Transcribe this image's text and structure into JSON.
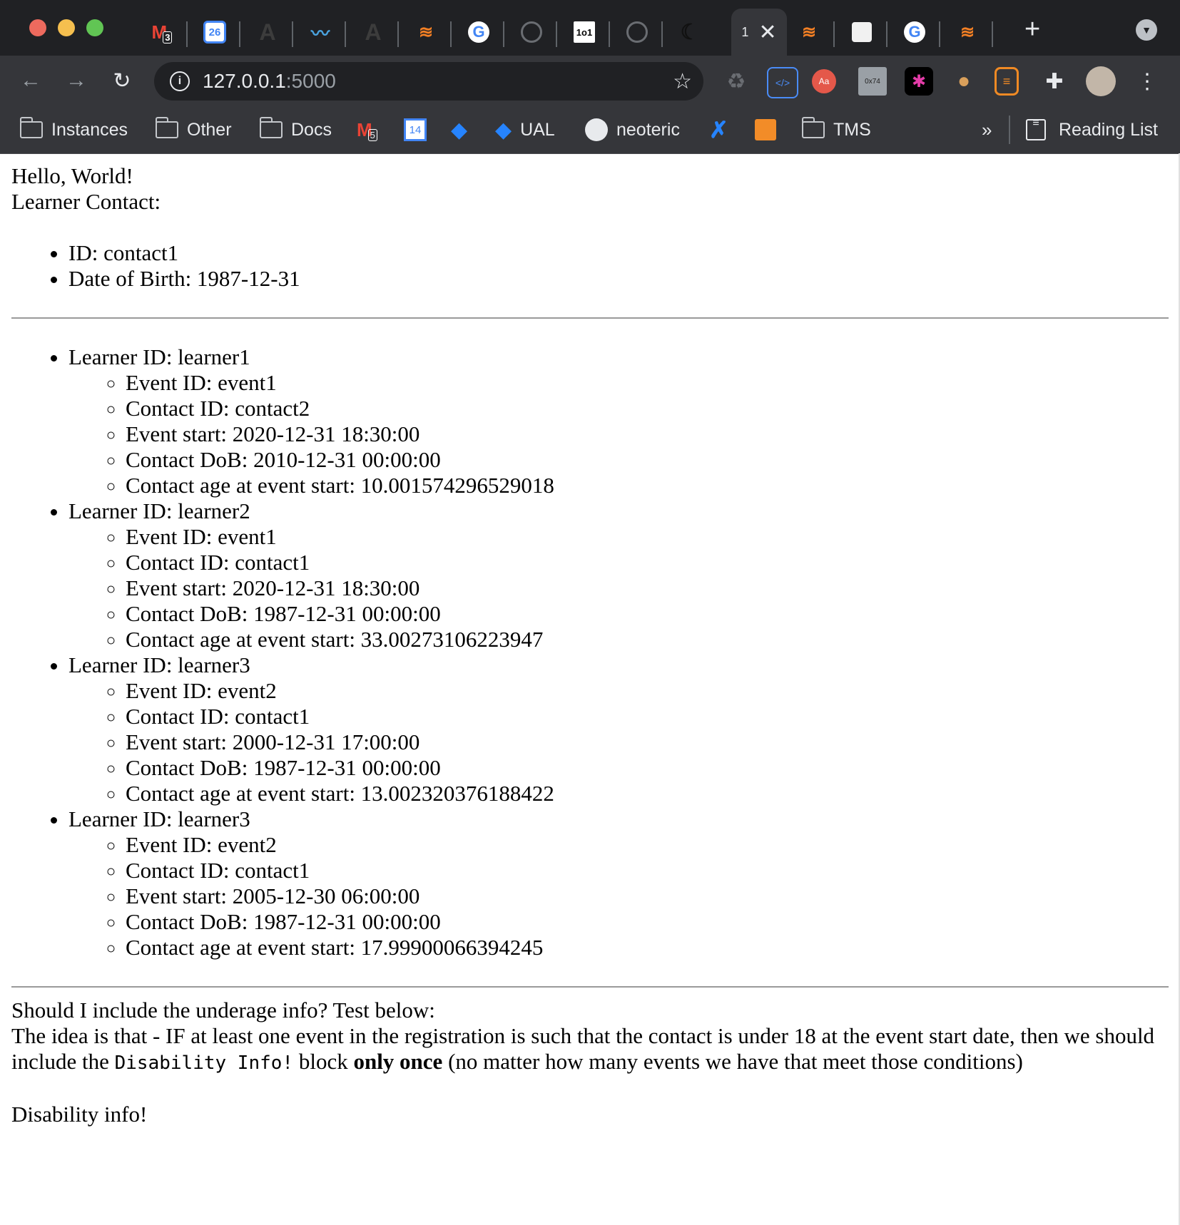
{
  "tabs": [
    {
      "icon": "gmail-icon",
      "badge": "3"
    },
    {
      "icon": "google-calendar-icon",
      "badge": "26"
    },
    {
      "icon": "font-a-icon"
    },
    {
      "icon": "wave-bird-icon"
    },
    {
      "icon": "font-a-icon"
    },
    {
      "icon": "stackoverflow-icon"
    },
    {
      "icon": "google-icon"
    },
    {
      "icon": "globe-icon"
    },
    {
      "icon": "101-icon",
      "text": "1o1"
    },
    {
      "icon": "globe-icon"
    },
    {
      "icon": "moon-icon"
    },
    {
      "icon": "active-tab",
      "text": "1"
    },
    {
      "icon": "stackoverflow-icon"
    },
    {
      "icon": "cube-icon"
    },
    {
      "icon": "google-icon"
    },
    {
      "icon": "stackoverflow-icon"
    }
  ],
  "toolbar": {
    "url_host": "127.0.0.1",
    "url_port": ":5000",
    "ext_hex": "0x74"
  },
  "bookmarks": {
    "instances": "Instances",
    "other": "Other",
    "docs": "Docs",
    "gmail_badge": "5",
    "calendar_badge": "14",
    "ual": "UAL",
    "neoteric": "neoteric",
    "tms": "TMS",
    "more": "»",
    "reading_list": "Reading List"
  },
  "page": {
    "hello": "Hello, World!",
    "learner_contact": "Learner Contact:",
    "contact_items": [
      "ID: contact1",
      "Date of Birth: 1987-12-31"
    ],
    "learners": [
      {
        "label": "Learner ID: learner1",
        "details": [
          "Event ID: event1",
          "Contact ID: contact2",
          "Event start: 2020-12-31 18:30:00",
          "Contact DoB: 2010-12-31 00:00:00",
          "Contact age at event start: 10.001574296529018"
        ]
      },
      {
        "label": "Learner ID: learner2",
        "details": [
          "Event ID: event1",
          "Contact ID: contact1",
          "Event start: 2020-12-31 18:30:00",
          "Contact DoB: 1987-12-31 00:00:00",
          "Contact age at event start: 33.00273106223947"
        ]
      },
      {
        "label": "Learner ID: learner3",
        "details": [
          "Event ID: event2",
          "Contact ID: contact1",
          "Event start: 2000-12-31 17:00:00",
          "Contact DoB: 1987-12-31 00:00:00",
          "Contact age at event start: 13.002320376188422"
        ]
      },
      {
        "label": "Learner ID: learner3",
        "details": [
          "Event ID: event2",
          "Contact ID: contact1",
          "Event start: 2005-12-30 06:00:00",
          "Contact DoB: 1987-12-31 00:00:00",
          "Contact age at event start: 17.99900066394245"
        ]
      }
    ],
    "question": "Should I include the underage info? Test below:",
    "idea_part1": "The idea is that - IF at least one event in the registration is such that the contact is under 18 at the event start date, then we should include the ",
    "idea_code": "Disability Info!",
    "idea_part2": " block ",
    "idea_bold": "only once",
    "idea_part3": " (no matter how many events we have that meet those conditions)",
    "disability": "Disability info!"
  },
  "colors": {
    "chrome_bg": "#202124",
    "toolbar_bg": "#35363a",
    "close": "#ed6a5e",
    "minimize": "#f5bf4f",
    "maximize": "#61c554"
  }
}
